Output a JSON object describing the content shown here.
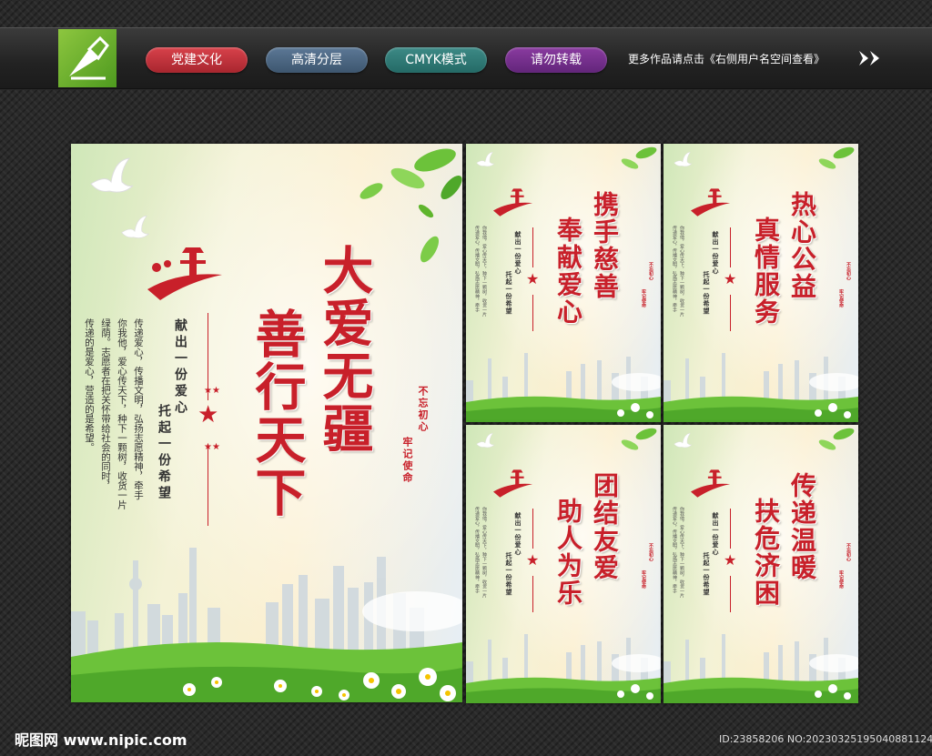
{
  "header": {
    "tags": [
      "党建文化",
      "高清分层",
      "CMYK模式",
      "请勿转载"
    ],
    "more_text": "更多作品请点击《右侧用户名空间查看》"
  },
  "main_poster": {
    "title_col1": "大爱无疆",
    "title_col2": "善行天下",
    "slogan_col1": "献出一份爱心",
    "slogan_col2": "托起一份希望",
    "body": [
      "传递爱心，传播文明，弘扬志愿精神，牵手",
      "你我他，爱心传天下，种下一颗树，收货一片",
      "绿荫。志愿者在把关怀带给社会的同时，",
      "传递的是爱心，营造的是希望。"
    ],
    "seal_col1": "不忘初心",
    "seal_col2": "牢记使命"
  },
  "small_posters": [
    {
      "title_col1": "携手慈善",
      "title_col2": "奉献爱心"
    },
    {
      "title_col1": "热心公益",
      "title_col2": "真情服务"
    },
    {
      "title_col1": "团结友爱",
      "title_col2": "助人为乐"
    },
    {
      "title_col1": "传递温暖",
      "title_col2": "扶危济困"
    }
  ],
  "small_common": {
    "slogan_col1": "献出一份爱心",
    "slogan_col2": "托起一份希望",
    "seal_col1": "不忘初心",
    "seal_col2": "牢记使命"
  },
  "footer": {
    "brand": "昵图网 www.nipic.com",
    "id_text": "ID:23858206 NO:20230325195040881124"
  },
  "colors": {
    "title_red": "#c8202a",
    "grass_green": "#5fb52c",
    "logo_green": "#8dc63f"
  }
}
